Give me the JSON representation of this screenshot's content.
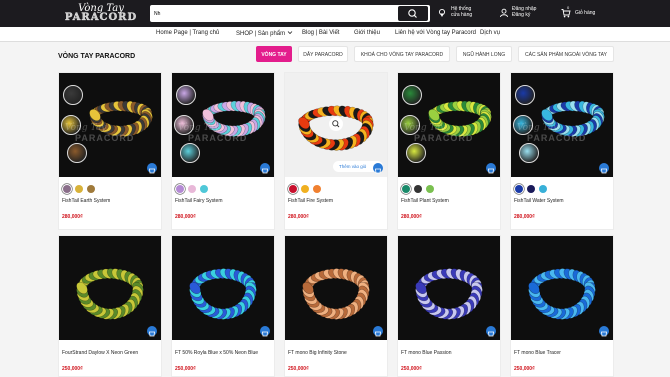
{
  "header": {
    "logo_line1": "Vòng Tay",
    "logo_line2": "PARACORD",
    "search_value": "Nh",
    "store_line1": "Hệ thống",
    "store_line2": "cửa hàng",
    "account_line1": "Đăng nhập",
    "account_line2": "Đăng ký",
    "cart_count": "0",
    "cart_label": "Giỏ hàng"
  },
  "nav": {
    "items": [
      "Home Page | Trang chủ",
      "SHOP | Sản phẩm",
      "Blog | Bài Viết",
      "Giới thiệu",
      "Liên hệ với Vòng tay Paracord",
      "Dịch vụ"
    ]
  },
  "section": {
    "title": "VÒNG TAY PARACORD",
    "tabs": [
      "VÒNG TAY",
      "DÂY PARACORD",
      "KHOÁ CHO VÒNG TAY PARACORD",
      "NGŨ HÀNH LONG",
      "CÁC SẢN PHẨM NGOÀI VÒNG TAY"
    ]
  },
  "products_row1": [
    {
      "name": "FishTail Earth System",
      "price": "280,000₫",
      "swatches": [
        "#8a6e8a",
        "#d8b23a",
        "#a07a3a"
      ],
      "colors": [
        "#3a3a3a",
        "#e7c43a",
        "#8b5a2b"
      ]
    },
    {
      "name": "FishTail Fairy System",
      "price": "280,000₫",
      "swatches": [
        "#b48ad4",
        "#e8b8d8",
        "#4fc8d8"
      ],
      "colors": [
        "#c9a7e6",
        "#f0c0dc",
        "#5cd0dc"
      ]
    },
    {
      "name": "FishTail Fire System",
      "price": "280,000₫",
      "swatches": [
        "#c8102e",
        "#f0b020",
        "#f08030"
      ],
      "colors": [
        "#1a1a1a",
        "#e83a10",
        "#f6b21f"
      ]
    },
    {
      "name": "FishTail Plant System",
      "price": "280,000₫",
      "swatches": [
        "#1a8a6a",
        "#333333",
        "#7ac050"
      ],
      "colors": [
        "#2a8a3a",
        "#9ad040",
        "#d8e840"
      ]
    },
    {
      "name": "FishTail Water System",
      "price": "280,000₫",
      "swatches": [
        "#1a3aa8",
        "#1a1a5a",
        "#38b0d8"
      ],
      "colors": [
        "#1a3aa8",
        "#38b8e0",
        "#9ae0f0"
      ]
    }
  ],
  "products_row2": [
    {
      "name": "FourStrand Daylow X Neon Green",
      "price": "250,000₫",
      "colors": [
        "#c8c838",
        "#5a8a2a"
      ]
    },
    {
      "name": "FT 50% Royla Blue x 50% Neon Blue",
      "price": "250,000₫",
      "colors": [
        "#2a5ad8",
        "#3ad0e0"
      ]
    },
    {
      "name": "FT mono Big Infinity Stone",
      "price": "250,000₫",
      "colors": [
        "#b86a3a",
        "#f0b080"
      ]
    },
    {
      "name": "FT mono Blue Passion",
      "price": "250,000₫",
      "colors": [
        "#3a3ab8",
        "#c8c8f0"
      ]
    },
    {
      "name": "FT mono Blue Tracer",
      "price": "250,000₫",
      "colors": [
        "#1a6ad8",
        "#4ab8f0"
      ]
    }
  ],
  "add_to_cart_label": "Thêm vào giỏ",
  "icons": {
    "search": "search-icon",
    "store": "store-icon",
    "account": "user-icon",
    "cart": "cart-icon",
    "zoom": "zoom-icon",
    "chevron": "chevron-down-icon"
  },
  "colors": {
    "header_bg": "#1c1b1f",
    "accent_pink": "#e31d8c",
    "price_red": "#d0121b",
    "badge_blue": "#2a7ad6"
  }
}
